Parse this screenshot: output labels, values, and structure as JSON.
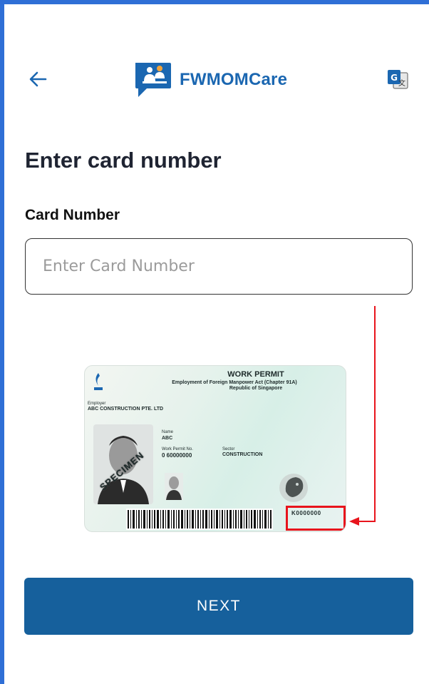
{
  "app": {
    "name": "FWMOMCare"
  },
  "header": {
    "back_icon": "arrow-left-icon",
    "logo_icon": "fwmomcare-logo-icon",
    "translate_icon": "google-translate-icon"
  },
  "page": {
    "title": "Enter card number"
  },
  "card_field": {
    "label": "Card Number",
    "value": "",
    "placeholder": "Enter Card Number"
  },
  "sample_card": {
    "title": "WORK PERMIT",
    "subtitle": "Employment of Foreign Manpower Act (Chapter 91A)",
    "country": "Republic of Singapore",
    "employer_caption": "Employer",
    "employer": "ABC CONSTRUCTION PTE. LTD",
    "name_caption": "Name",
    "name": "ABC",
    "permit_no_caption": "Work Permit No.",
    "permit_no": "0 60000000",
    "sector_caption": "Sector",
    "sector": "CONSTRUCTION",
    "watermark": "SPECIMEN",
    "serial": "K0000000"
  },
  "colors": {
    "brand": "#1b67b1",
    "button": "#16609c",
    "highlight": "#e8141c",
    "frame": "#2f6fd6"
  },
  "actions": {
    "next_label": "NEXT"
  }
}
